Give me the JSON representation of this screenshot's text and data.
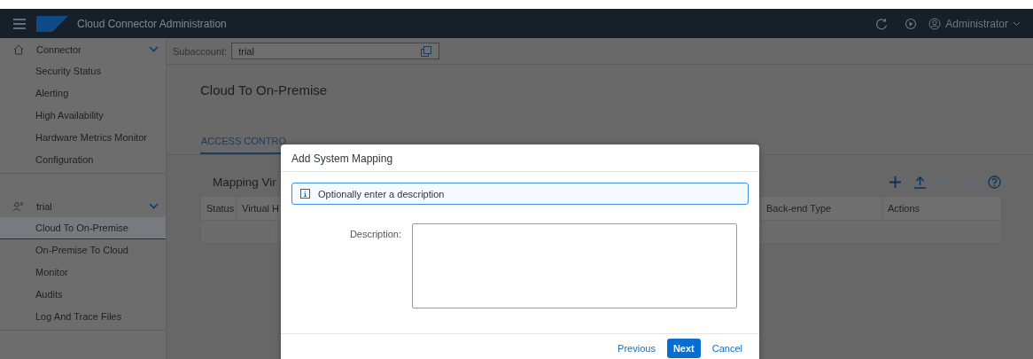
{
  "shell": {
    "title": "Cloud Connector Administration",
    "user": "Administrator"
  },
  "sidebar": {
    "groups": [
      {
        "label": "Connector",
        "kind": "home",
        "expanded": true,
        "items": [
          {
            "label": "Security Status",
            "selected": false
          },
          {
            "label": "Alerting",
            "selected": false
          },
          {
            "label": "High Availability",
            "selected": false
          },
          {
            "label": "Hardware Metrics Monitor",
            "selected": false
          },
          {
            "label": "Configuration",
            "selected": false
          }
        ]
      },
      {
        "label": "trial",
        "kind": "account",
        "expanded": true,
        "items": [
          {
            "label": "Cloud To On-Premise",
            "selected": true
          },
          {
            "label": "On-Premise To Cloud",
            "selected": false
          },
          {
            "label": "Monitor",
            "selected": false
          },
          {
            "label": "Audits",
            "selected": false
          },
          {
            "label": "Log And Trace Files",
            "selected": false
          }
        ]
      }
    ]
  },
  "subaccount": {
    "label": "Subaccount:",
    "value": "trial"
  },
  "page_title": "Cloud To On-Premise",
  "tabs": [
    {
      "label": "ACCESS CONTRO",
      "selected": true
    }
  ],
  "section_title": "Mapping Vir",
  "toolbar": [
    {
      "kind": "add",
      "disabled": false
    },
    {
      "kind": "upload",
      "disabled": false
    },
    {
      "kind": "download",
      "disabled": true
    },
    {
      "kind": "delete",
      "disabled": true
    },
    {
      "kind": "help",
      "disabled": false
    }
  ],
  "table": {
    "columns": [
      "Status",
      "Virtual H",
      "Back-end Type",
      "Actions"
    ]
  },
  "dialog": {
    "title": "Add System Mapping",
    "message": "Optionally enter a description",
    "field_label": "Description:",
    "buttons": [
      {
        "label": "Previous",
        "kind": "link"
      },
      {
        "label": "Next",
        "kind": "emphasized"
      },
      {
        "label": "Cancel",
        "kind": "link"
      }
    ]
  }
}
